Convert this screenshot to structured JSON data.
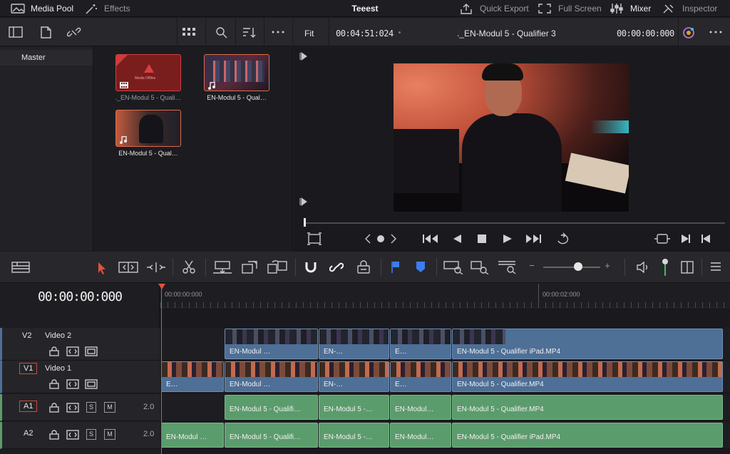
{
  "topbar": {
    "media_pool": "Media Pool",
    "effects": "Effects",
    "project": "Teeest",
    "quick_export": "Quick Export",
    "full_screen": "Full Screen",
    "mixer": "Mixer",
    "inspector": "Inspector"
  },
  "pool": {
    "bin": "Master",
    "clips": [
      {
        "name": "._EN-Modul 5 - Quali…",
        "offline": "Media Offline"
      },
      {
        "name": "EN-Modul 5 - Qual…"
      },
      {
        "name": "EN-Modul 5 - Qual…"
      }
    ]
  },
  "viewer": {
    "zoom": "Fit",
    "duration": "00:04:51:024",
    "clip_name": "._EN-Modul 5 - Qualifier 3",
    "timecode": "00:00:00:000"
  },
  "timeline": {
    "timecode": "00:00:00:000",
    "ruler": [
      "00:00:00:000",
      "00:00:02:000"
    ],
    "tracks": {
      "v2": {
        "id": "V2",
        "name": "Video 2"
      },
      "v1": {
        "id": "V1",
        "name": "Video 1"
      },
      "a1": {
        "id": "A1",
        "level": "2.0"
      },
      "a2": {
        "id": "A2",
        "level": "2.0"
      }
    },
    "solo": "S",
    "mute": "M",
    "v2_clips": [
      "EN-Modul …",
      "EN-…",
      "E…",
      "EN-Modul 5 - Qualifier iPad.MP4"
    ],
    "v1_clips": [
      "E…",
      "EN-Modul …",
      "EN-…",
      "E…",
      "EN-Modul 5 - Qualifier.MP4"
    ],
    "a1_clips": [
      "EN-Modul 5 - Qualifi…",
      "EN-Modul 5 -…",
      "EN-Modul…",
      "EN-Modul 5 - Qualifier.MP4"
    ],
    "a2_clips": [
      "EN-Modul …",
      "EN-Modul 5 - Qualifi…",
      "EN-Modul 5 -…",
      "EN-Modul…",
      "EN-Modul 5 - Qualifier iPad.MP4"
    ]
  },
  "colors": {
    "playhead": "#e0523b",
    "video_clip": "#4e6f96",
    "audio_clip": "#5b9c6c",
    "accent_blue": "#3d7cf0"
  }
}
